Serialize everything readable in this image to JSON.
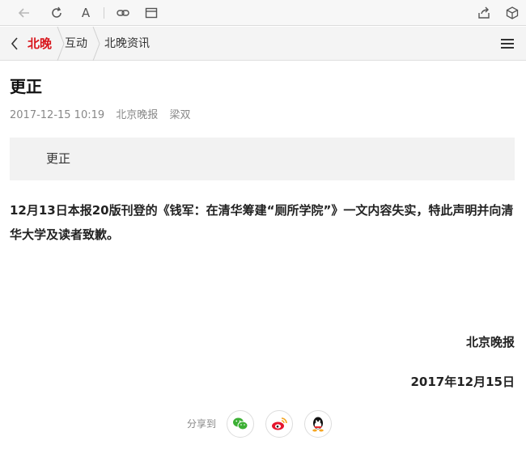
{
  "browser": {
    "icons": [
      "back-arrow-icon",
      "refresh-icon",
      "font-size-icon",
      "link-icon",
      "window-icon",
      "share-out-icon",
      "box-icon"
    ],
    "font_glyph": "A"
  },
  "nav": {
    "logo": "北晚",
    "crumbs": [
      "互动",
      "北晚资讯"
    ],
    "accent": "#d8141b"
  },
  "article": {
    "title": "更正",
    "meta": {
      "date": "2017-12-15 10:19",
      "source": "北京晚报",
      "author": "梁双"
    },
    "summary": "更正",
    "body": "12月13日本报20版刊登的《钱军：在清华筹建“厕所学院”》一文内容失实，特此声明并向清华大学及读者致歉。",
    "signature": "北京晚报",
    "sign_date": "2017年12月15日"
  },
  "share": {
    "label": "分享到",
    "targets": [
      "wechat-icon",
      "weibo-icon",
      "qq-icon"
    ]
  }
}
